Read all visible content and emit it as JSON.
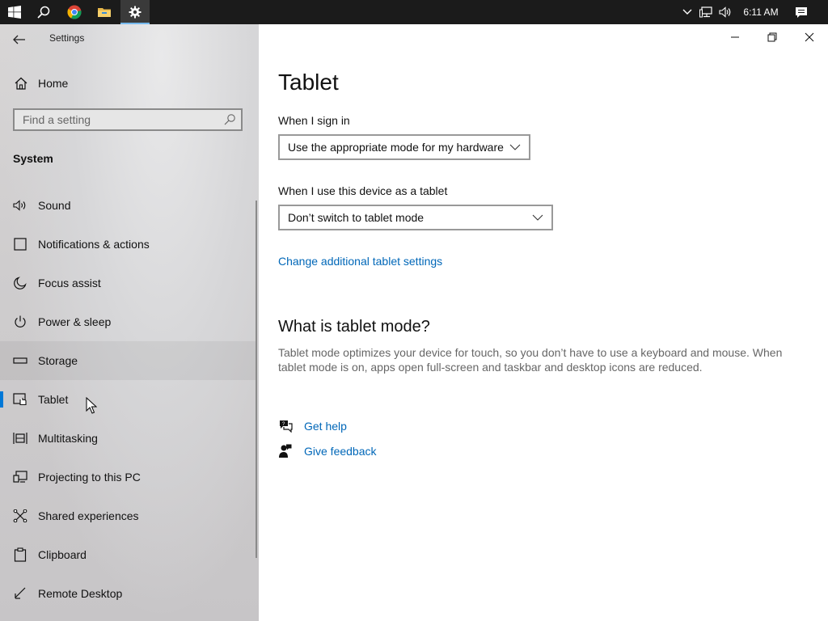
{
  "taskbar": {
    "start_icon": "windows-logo-icon",
    "search_icon": "search-icon",
    "apps": [
      "chrome-icon",
      "file-explorer-icon",
      "settings-gear-icon"
    ],
    "tray_icons": [
      "chevron-up-icon",
      "network-icon",
      "volume-icon"
    ],
    "clock": "6:11 AM",
    "notification_icon": "action-center-icon"
  },
  "sidebar": {
    "app_title": "Settings",
    "home_label": "Home",
    "search_placeholder": "Find a setting",
    "section_title": "System",
    "items": [
      {
        "label": "Sound",
        "icon": "speaker-icon"
      },
      {
        "label": "Notifications & actions",
        "icon": "notifications-icon"
      },
      {
        "label": "Focus assist",
        "icon": "moon-icon"
      },
      {
        "label": "Power & sleep",
        "icon": "power-icon"
      },
      {
        "label": "Storage",
        "icon": "storage-icon"
      },
      {
        "label": "Tablet",
        "icon": "tablet-icon"
      },
      {
        "label": "Multitasking",
        "icon": "multitasking-icon"
      },
      {
        "label": "Projecting to this PC",
        "icon": "projecting-icon"
      },
      {
        "label": "Shared experiences",
        "icon": "shared-experiences-icon"
      },
      {
        "label": "Clipboard",
        "icon": "clipboard-icon"
      },
      {
        "label": "Remote Desktop",
        "icon": "remote-desktop-icon"
      }
    ],
    "selected_item": "Tablet",
    "hover_item": "Storage"
  },
  "main": {
    "page_title": "Tablet",
    "sign_in_label": "When I sign in",
    "sign_in_value": "Use the appropriate mode for my hardware",
    "tablet_use_label": "When I use this device as a tablet",
    "tablet_use_value": "Don’t switch to tablet mode",
    "additional_link": "Change additional tablet settings",
    "what_is_heading": "What is tablet mode?",
    "what_is_text": "Tablet mode optimizes your device for touch, so you don’t have to use a keyboard and mouse. When tablet mode is on, apps open full-screen and taskbar and desktop icons are reduced.",
    "get_help": "Get help",
    "give_feedback": "Give feedback"
  },
  "colors": {
    "accent": "#0078d7",
    "link": "#0067b8",
    "taskbar": "#1b1b1b"
  }
}
